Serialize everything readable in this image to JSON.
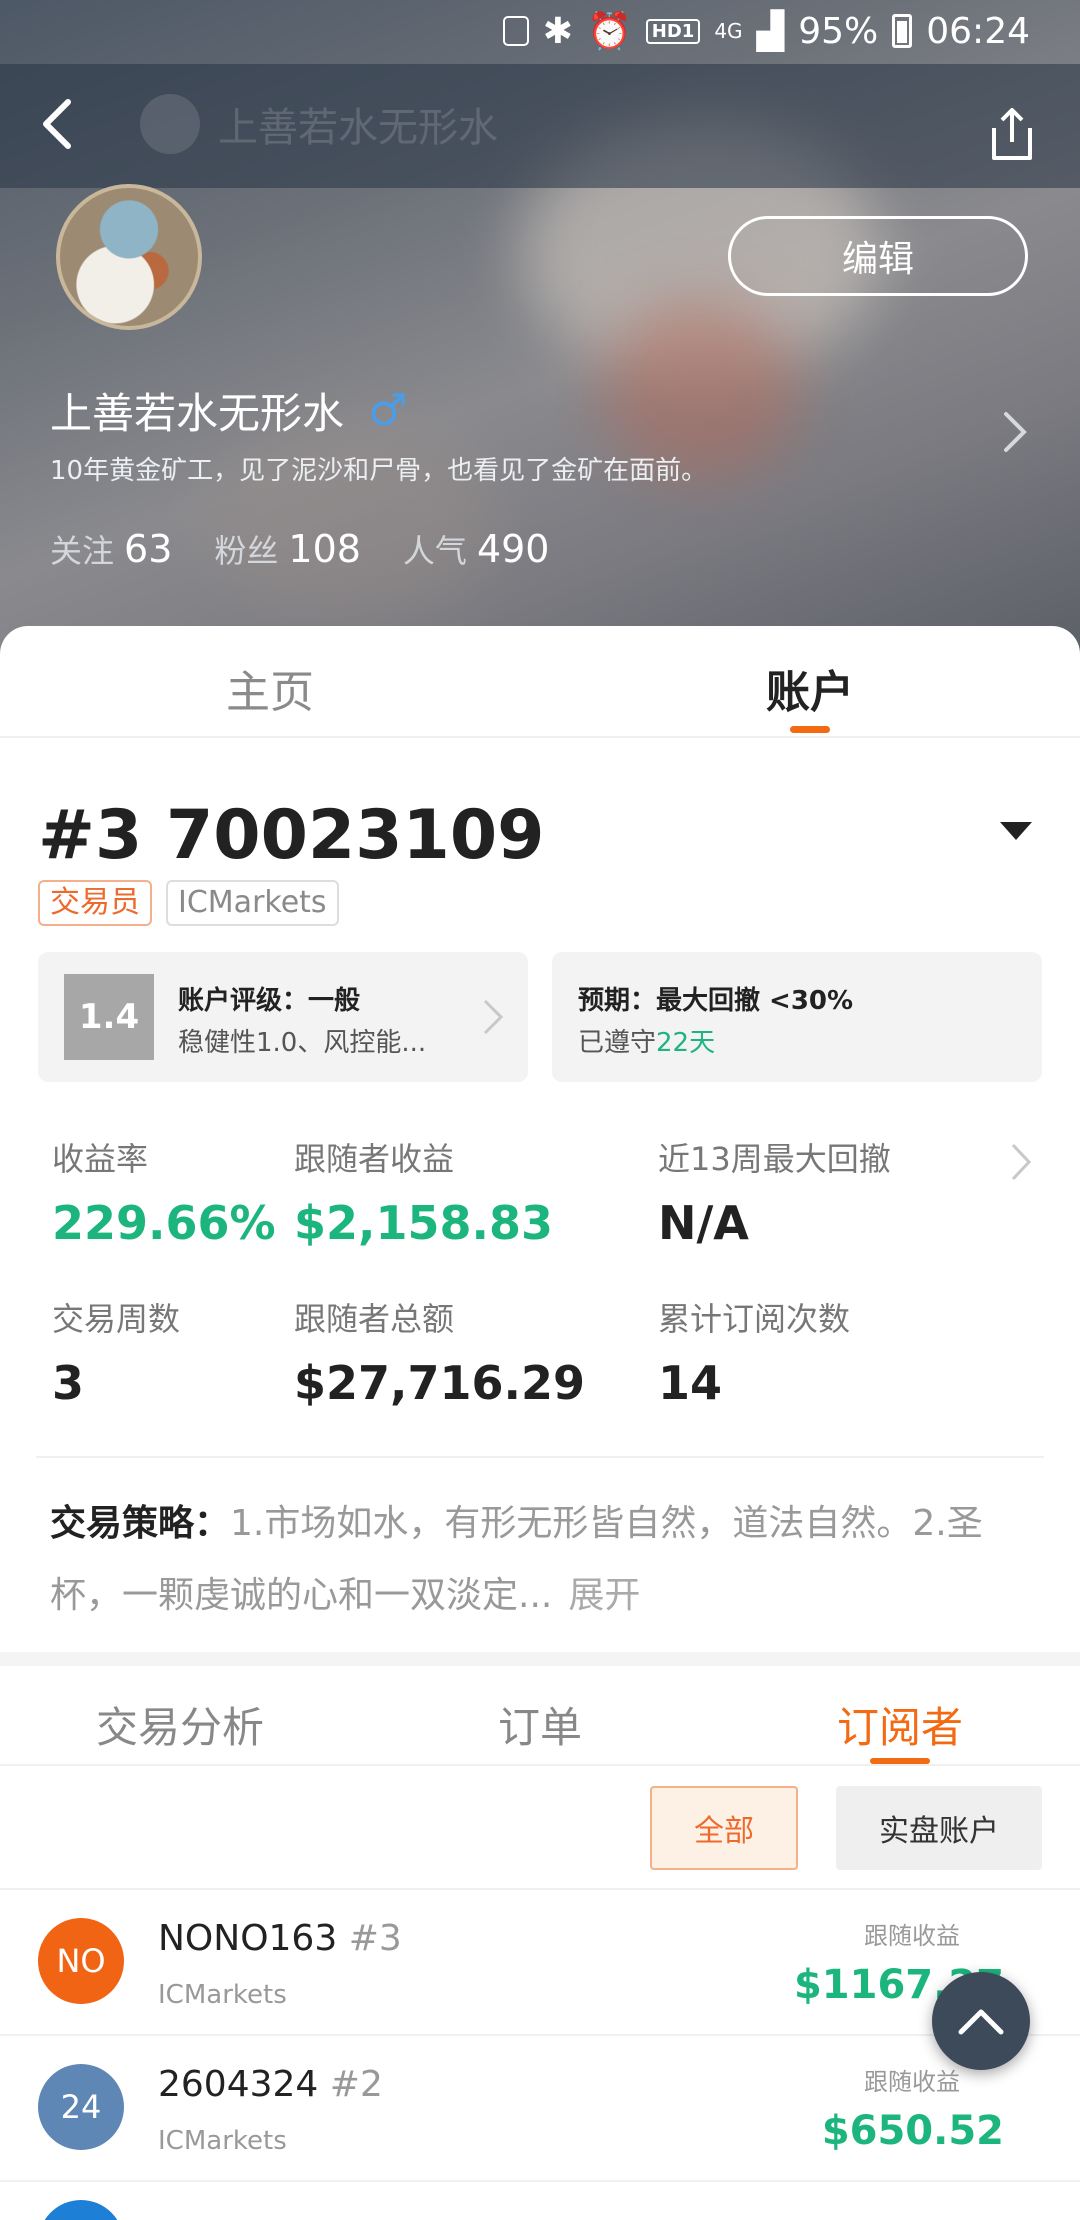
{
  "status_bar": {
    "battery": "95%",
    "time": "06:24",
    "network": "4G",
    "hd_badge": "HD1"
  },
  "nav": {
    "title": "上善若水无形水"
  },
  "profile": {
    "edit_label": "编辑",
    "name": "上善若水无形水",
    "gender_symbol": "♂",
    "bio": "10年黄金矿工，见了泥沙和尸骨，也看见了金矿在面前。",
    "stats": [
      {
        "label": "关注",
        "value": "63"
      },
      {
        "label": "粉丝",
        "value": "108"
      },
      {
        "label": "人气",
        "value": "490"
      }
    ]
  },
  "top_tabs": [
    {
      "label": "主页"
    },
    {
      "label": "账户"
    }
  ],
  "account": {
    "number": "#3 70023109",
    "tags": {
      "role": "交易员",
      "broker": "ICMarkets"
    },
    "rating": {
      "score": "1.4",
      "title": "账户评级：一般",
      "detail": "稳健性1.0、风控能..."
    },
    "expectation": {
      "title": "预期：最大回撤 <30%",
      "prefix": "已遵守",
      "days": "22天"
    }
  },
  "metrics": [
    {
      "label": "收益率",
      "value": "229.66%"
    },
    {
      "label": "跟随者收益",
      "value": "$2,158.83"
    },
    {
      "label": "近13周最大回撤",
      "value": "N/A"
    },
    {
      "label": "交易周数",
      "value": "3"
    },
    {
      "label": "跟随者总额",
      "value": "$27,716.29"
    },
    {
      "label": "累计订阅次数",
      "value": "14"
    }
  ],
  "strategy": {
    "label": "交易策略：",
    "text": "1.市场如水，有形无形皆自然，道法自然。2.圣杯，一颗虔诚的心和一双淡定...",
    "expand": "展开"
  },
  "sub_tabs": [
    {
      "label": "交易分析"
    },
    {
      "label": "订单"
    },
    {
      "label": "订阅者"
    }
  ],
  "filters": {
    "all": "全部",
    "real": "实盘账户"
  },
  "subscribers": [
    {
      "initials": "NO",
      "name": "NONO163",
      "rank": "#3",
      "broker": "ICMarkets",
      "profit_label": "跟随收益",
      "profit": "$1167.27",
      "color": "#f06413"
    },
    {
      "initials": "24",
      "name": "2604324",
      "rank": "#2",
      "broker": "ICMarkets",
      "profit_label": "跟随收益",
      "profit": "$650.52",
      "color": "#5e87b5"
    }
  ],
  "colors": {
    "accent": "#f26a12",
    "positive": "#1bb57d",
    "male_icon": "#4a9de8"
  }
}
